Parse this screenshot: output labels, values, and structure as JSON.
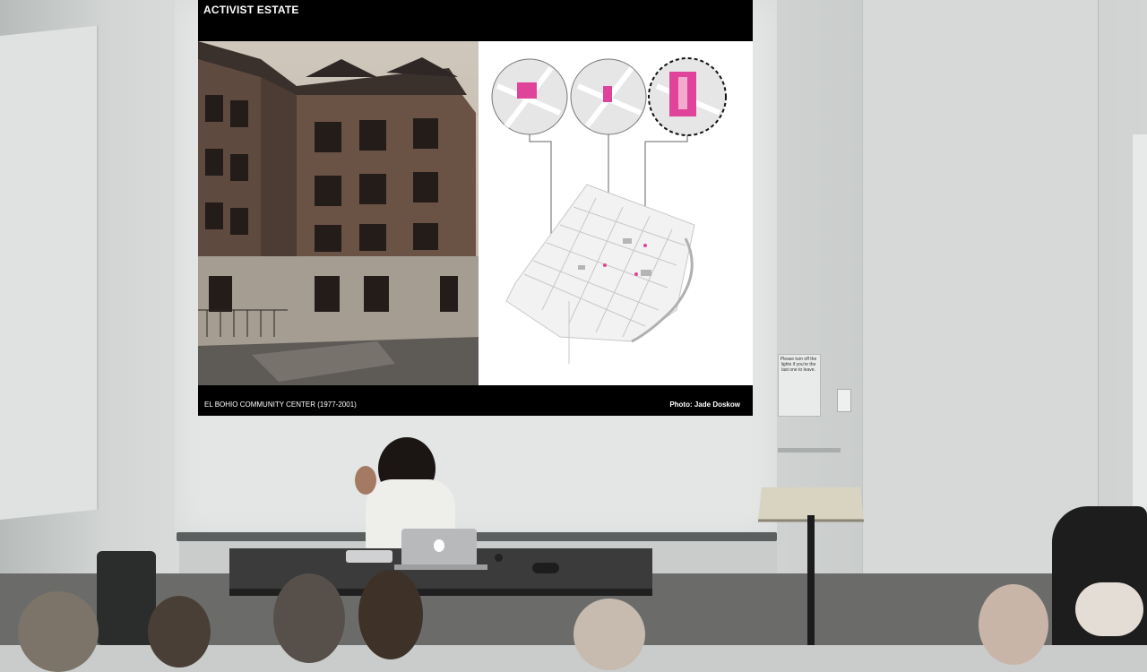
{
  "slide": {
    "title": "ACTIVIST ESTATE",
    "caption": "EL BOHIO COMMUNITY CENTER (1977-2001)",
    "credit": "Photo: Jade Doskow"
  },
  "sign": {
    "text": "Please turn off the lights if you're the last one to leave."
  },
  "colors": {
    "slide_header": "#000000",
    "map_highlight": "#e0449a",
    "wall": "#d6d9d8"
  }
}
